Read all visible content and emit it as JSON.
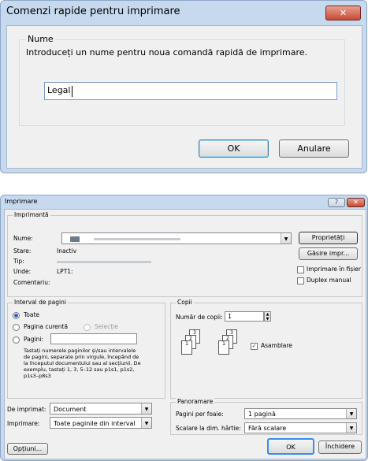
{
  "dialog1": {
    "title": "Comenzi rapide pentru imprimare",
    "close_label": "✕",
    "group_label": "Nume",
    "prompt": "Introduceți un nume pentru noua comandă rapidă de imprimare.",
    "name_value": "Legal",
    "ok_label": "OK",
    "cancel_label": "Anulare"
  },
  "dialog2": {
    "title": "Imprimare",
    "help_label": "?",
    "close_label": "✕",
    "printer": {
      "section_label": "Imprimantă",
      "name_label": "Nume:",
      "status_label": "Stare:",
      "status_value": "Inactiv",
      "type_label": "Tip:",
      "where_label": "Unde:",
      "where_value": "LPT1:",
      "comment_label": "Comentariu:",
      "properties_label": "Proprietăți",
      "find_label": "Găsire impr...",
      "print_to_file_label": "Imprimare în fișier",
      "duplex_label": "Duplex manual"
    },
    "range": {
      "section_label": "Interval de pagini",
      "all_label": "Toate",
      "current_label": "Pagina curentă",
      "selection_label": "Selecție",
      "pages_label": "Pagini:",
      "hint": "Tastați numerele paginilor și/sau intervalele de pagini, separate prin virgule, începând de la începutul documentului sau al secțiunii. De exemplu, tastați 1, 3, 5–12 sau p1s1, p1s2, p1s3–p8s3"
    },
    "copies": {
      "section_label": "Copii",
      "count_label": "Număr de copii:",
      "count_value": "1",
      "collate_label": "Asamblare",
      "pages": [
        "1",
        "2",
        "3",
        "1",
        "2",
        "3"
      ]
    },
    "print_what_label": "De imprimat:",
    "print_what_value": "Document",
    "print_label": "Imprimare:",
    "print_value": "Toate paginile din interval",
    "zoom": {
      "section_label": "Panoramare",
      "pps_label": "Pagini per foaie:",
      "pps_value": "1 pagină",
      "scale_label": "Scalare la dim. hârtie:",
      "scale_value": "Fără scalare"
    },
    "options_label": "Opțiuni...",
    "ok_label": "OK",
    "close_button_label": "Închidere"
  }
}
